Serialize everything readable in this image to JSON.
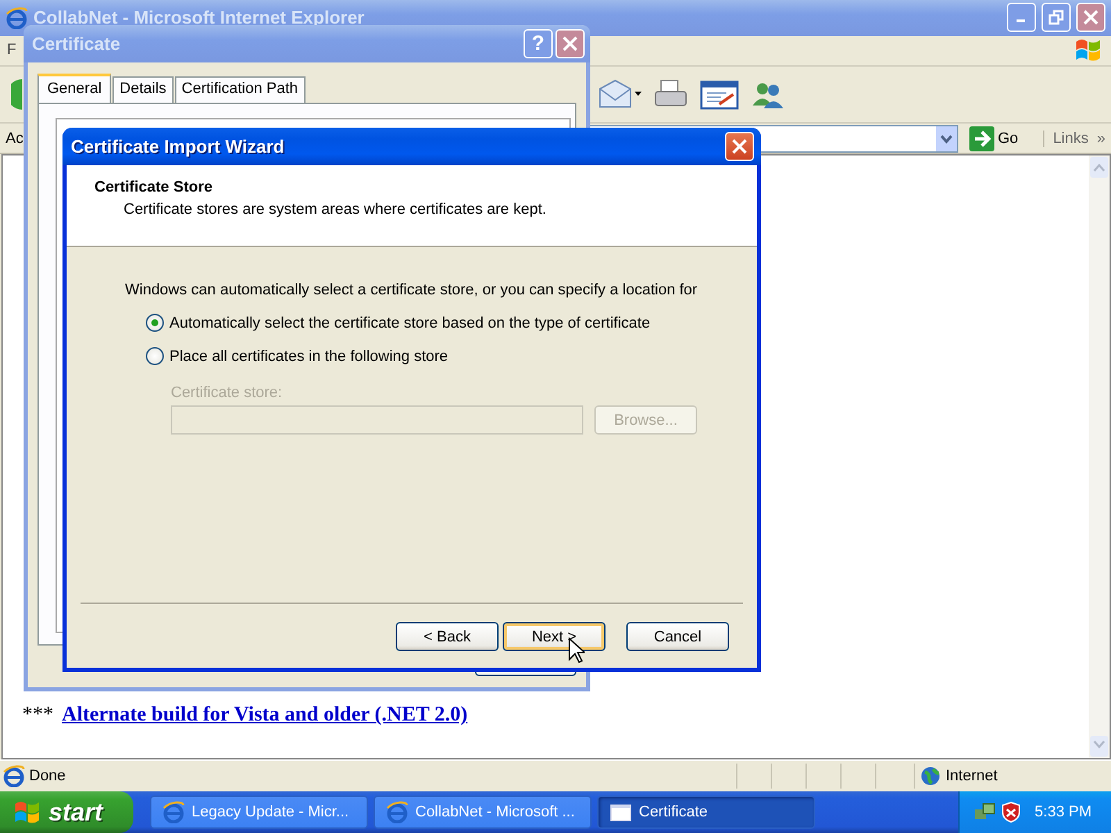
{
  "browser": {
    "title": "CollabNet - Microsoft Internet Explorer",
    "menu_fragment": "F",
    "address_fragment": "Ac",
    "go": "Go",
    "links": "Links",
    "links_more": "»",
    "page_line": {
      "prefix": "***",
      "link": "Alternate build for Vista and older (.NET 2.0)"
    },
    "status": "Done",
    "zone": "Internet"
  },
  "certificate_dialog": {
    "title": "Certificate",
    "help": "?",
    "tabs": [
      {
        "label": "General",
        "selected": true
      },
      {
        "label": "Details",
        "selected": false
      },
      {
        "label": "Certification Path",
        "selected": false
      }
    ]
  },
  "wizard": {
    "title": "Certificate Import Wizard",
    "heading": "Certificate Store",
    "subtitle": "Certificate stores are system areas where certificates are kept.",
    "intro": "Windows can automatically select a certificate store, or you can specify a location for",
    "options": [
      {
        "label": "Automatically select the certificate store based on the type of certificate",
        "selected": true
      },
      {
        "label": "Place all certificates in the following store",
        "selected": false
      }
    ],
    "store": {
      "label": "Certificate store:",
      "disabled": true
    },
    "browse": {
      "label": "Browse...",
      "disabled": true
    },
    "buttons": [
      {
        "label": "< Back",
        "default": false
      },
      {
        "label": "Next >",
        "default": true
      },
      {
        "label": "Cancel",
        "default": false
      }
    ]
  },
  "taskbar": {
    "start": "start",
    "tasks": [
      {
        "label": "Legacy Update - Micr...",
        "kind": "browser",
        "selected": false
      },
      {
        "label": "CollabNet - Microsoft ...",
        "kind": "browser",
        "selected": false
      },
      {
        "label": "Certificate",
        "kind": "dialog",
        "selected": true
      }
    ],
    "clock": "5:33 PM"
  }
}
